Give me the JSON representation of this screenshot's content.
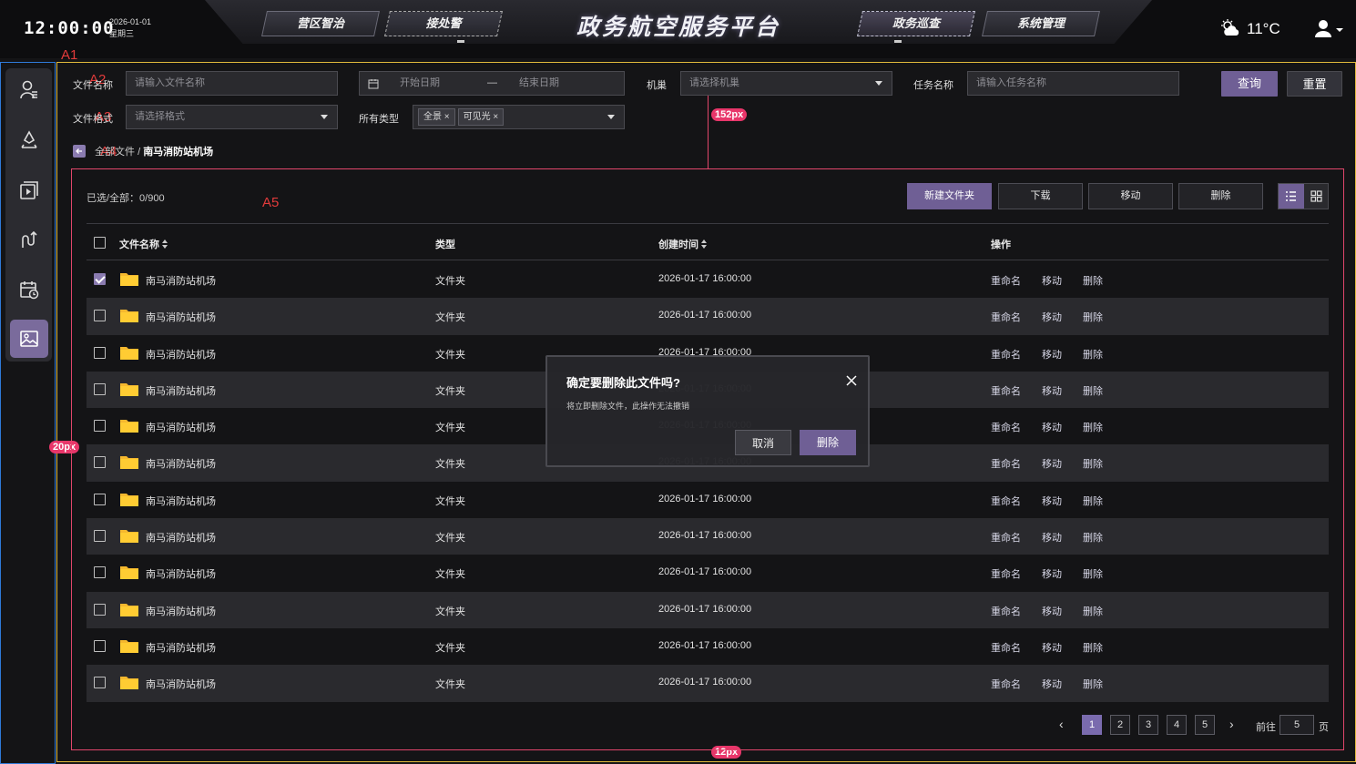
{
  "header": {
    "time": "12:00:00",
    "date": "2026-01-01",
    "weekday": "星期三",
    "title": "政务航空服务平台",
    "nav": [
      "营区智治",
      "接处警",
      "政务巡查",
      "系统管理"
    ],
    "temperature": "11°C",
    "weather_icon": "partly-cloudy-icon"
  },
  "annotations": {
    "a1": "A1",
    "a2": "A2",
    "a3": "A3",
    "a4": "A4",
    "a5": "A5",
    "m1": "152px",
    "m2": "20px",
    "m3": "12px"
  },
  "filters": {
    "file_name_label": "文件名称",
    "file_name_placeholder": "请输入文件名称",
    "start_date": "开始日期",
    "range_sep": "—",
    "end_date": "结束日期",
    "nest_label": "机巢",
    "nest_placeholder": "请选择机巢",
    "task_label": "任务名称",
    "task_placeholder": "请输入任务名称",
    "query_label": "查询",
    "reset_label": "重置",
    "format_label": "文件格式",
    "format_placeholder": "请选择格式",
    "type_label": "所有类型",
    "type_tags": [
      "全景",
      "可见光"
    ]
  },
  "breadcrumb": {
    "root": "全部文件",
    "sep": "/",
    "current": "南马消防站机场"
  },
  "toolbar": {
    "selected_count": "已选/全部：0/900",
    "new_folder": "新建文件夹",
    "download": "下载",
    "move": "移动",
    "delete": "删除"
  },
  "table": {
    "columns": [
      "文件名称",
      "类型",
      "创建时间",
      "操作"
    ],
    "actions": [
      "重命名",
      "移动",
      "删除"
    ],
    "rows": [
      {
        "name": "南马消防站机场",
        "type": "文件夹",
        "created": "2026-01-17 16:00:00",
        "checked": true
      },
      {
        "name": "南马消防站机场",
        "type": "文件夹",
        "created": "2026-01-17 16:00:00",
        "checked": false
      },
      {
        "name": "南马消防站机场",
        "type": "文件夹",
        "created": "2026-01-17 16:00:00",
        "checked": false
      },
      {
        "name": "南马消防站机场",
        "type": "文件夹",
        "created": "2026-01-17 16:00:00",
        "checked": false
      },
      {
        "name": "南马消防站机场",
        "type": "文件夹",
        "created": "2026-01-17 16:00:00",
        "checked": false
      },
      {
        "name": "南马消防站机场",
        "type": "文件夹",
        "created": "2026-01-17 16:00:00",
        "checked": false
      },
      {
        "name": "南马消防站机场",
        "type": "文件夹",
        "created": "2026-01-17 16:00:00",
        "checked": false
      },
      {
        "name": "南马消防站机场",
        "type": "文件夹",
        "created": "2026-01-17 16:00:00",
        "checked": false
      },
      {
        "name": "南马消防站机场",
        "type": "文件夹",
        "created": "2026-01-17 16:00:00",
        "checked": false
      },
      {
        "name": "南马消防站机场",
        "type": "文件夹",
        "created": "2026-01-17 16:00:00",
        "checked": false
      },
      {
        "name": "南马消防站机场",
        "type": "文件夹",
        "created": "2026-01-17 16:00:00",
        "checked": false
      },
      {
        "name": "南马消防站机场",
        "type": "文件夹",
        "created": "2026-01-17 16:00:00",
        "checked": false
      }
    ]
  },
  "pagination": {
    "pages": [
      "1",
      "2",
      "3",
      "4",
      "5"
    ],
    "current": "1",
    "goto_label": "前往",
    "goto_value": "5",
    "page_suffix": "页"
  },
  "modal": {
    "title": "确定要删除此文件吗?",
    "message": "将立即删除文件，此操作无法撤销",
    "cancel": "取消",
    "confirm": "删除"
  },
  "colors": {
    "accent": "#6f5f95",
    "folder": "#f5b82e",
    "background": "#141416"
  }
}
